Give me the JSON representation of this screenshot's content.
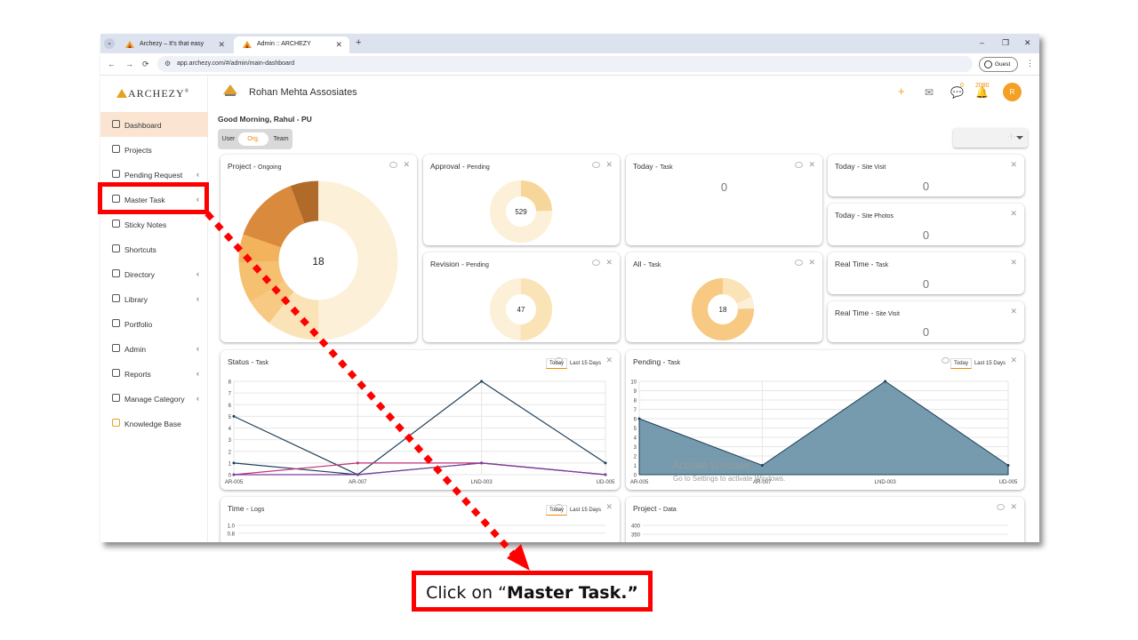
{
  "browser": {
    "tabs": [
      {
        "title": "Archezy – It's that easy"
      },
      {
        "title": "Admin :: ARCHEZY"
      }
    ],
    "url": "app.archezy.com/#/admin/main-dashboard",
    "profile_label": "Guest"
  },
  "sidebar": {
    "brand": "ARCHEZY",
    "items": [
      {
        "label": "Dashboard",
        "icon": "home-icon",
        "active": true
      },
      {
        "label": "Projects",
        "icon": "clipboard-icon"
      },
      {
        "label": "Pending Request",
        "icon": "clipboard-clock-icon",
        "has_submenu": true
      },
      {
        "label": "Master Task",
        "icon": "checklist-icon",
        "has_submenu": true
      },
      {
        "label": "Sticky Notes",
        "icon": "note-icon"
      },
      {
        "label": "Shortcuts",
        "icon": "shortcut-icon"
      },
      {
        "label": "Directory",
        "icon": "book-icon",
        "has_submenu": true
      },
      {
        "label": "Library",
        "icon": "library-icon",
        "has_submenu": true
      },
      {
        "label": "Portfolio",
        "icon": "folder-icon"
      },
      {
        "label": "Admin",
        "icon": "shield-icon",
        "has_submenu": true
      },
      {
        "label": "Reports",
        "icon": "report-icon",
        "has_submenu": true
      },
      {
        "label": "Manage Category",
        "icon": "category-icon",
        "has_submenu": true
      },
      {
        "label": "Knowledge Base",
        "icon": "bulb-icon"
      }
    ]
  },
  "header": {
    "firm_name": "Rohan Mehta Assosiates",
    "chat_count": "0",
    "notification_count": "2080",
    "avatar_initial": "R"
  },
  "greeting": "Good Morning, Rahul - PU",
  "view_toggle": {
    "options": [
      "User",
      "Org.",
      "Team"
    ],
    "selected": "Org."
  },
  "dropdown_placeholder": "- | -",
  "cards": {
    "project": {
      "title": "Project - ",
      "sub": "Ongoing",
      "center": "18"
    },
    "approval": {
      "title": "Approval - ",
      "sub": "Pending",
      "center": "529"
    },
    "revision": {
      "title": "Revision - ",
      "sub": "Pending",
      "center": "47"
    },
    "today_task": {
      "title": "Today - ",
      "sub": "Task",
      "value": "0"
    },
    "all_task": {
      "title": "All - ",
      "sub": "Task",
      "center": "18"
    },
    "today_site_visit": {
      "title": "Today - ",
      "sub": "Site Visit",
      "value": "0"
    },
    "today_site_photos": {
      "title": "Today - ",
      "sub": "Site Photos",
      "value": "0"
    },
    "realtime_task": {
      "title": "Real Time - ",
      "sub": "Task",
      "value": "0"
    },
    "realtime_site_visit": {
      "title": "Real Time - ",
      "sub": "Site Visit",
      "value": "0"
    },
    "status_task": {
      "title": "Status - ",
      "sub": "Task"
    },
    "pending_task": {
      "title": "Pending - ",
      "sub": "Task"
    },
    "time_logs": {
      "title": "Time - ",
      "sub": "Logs"
    },
    "project_data": {
      "title": "Project - ",
      "sub": "Data"
    }
  },
  "range_toggle": {
    "today": "Today",
    "last15": "Last 15 Days"
  },
  "chart_data": [
    {
      "type": "line",
      "name": "status-task",
      "categories": [
        "AR-005",
        "AR-007",
        "LND-003",
        "UD-005"
      ],
      "yticks": [
        "0",
        "1",
        "2",
        "3",
        "4",
        "5",
        "6",
        "7",
        "8"
      ],
      "ylim": [
        0,
        8
      ],
      "series": [
        {
          "color": "#1f3f57",
          "values": [
            5,
            0,
            8,
            1
          ]
        },
        {
          "color": "#1f3f57",
          "values": [
            1,
            0,
            1,
            0
          ]
        },
        {
          "color": "#c0307a",
          "values": [
            0,
            1,
            1,
            0
          ]
        },
        {
          "color": "#7a3fa0",
          "values": [
            0,
            0,
            1,
            0
          ]
        }
      ]
    },
    {
      "type": "area",
      "name": "pending-task",
      "categories": [
        "AR-005",
        "AR-007",
        "LND-003",
        "UD-005"
      ],
      "yticks": [
        "0",
        "1",
        "2",
        "3",
        "4",
        "5",
        "6",
        "7",
        "8",
        "9",
        "10"
      ],
      "ylim": [
        0,
        10
      ],
      "series": [
        {
          "color": "#5f8aa0",
          "values": [
            6,
            1,
            10,
            1
          ]
        }
      ]
    },
    {
      "type": "line",
      "name": "time-logs",
      "yticks": [
        "1.0",
        "0.8"
      ],
      "ylim": [
        0,
        1
      ]
    },
    {
      "type": "line",
      "name": "project-data",
      "yticks": [
        "400",
        "350"
      ],
      "ylim": [
        0,
        400
      ]
    }
  ],
  "watermark": {
    "line1": "Activate Windows",
    "line2": "Go to Settings to activate Windows."
  },
  "instruction": {
    "prefix": "Click on “",
    "bold": "Master Task.”"
  }
}
